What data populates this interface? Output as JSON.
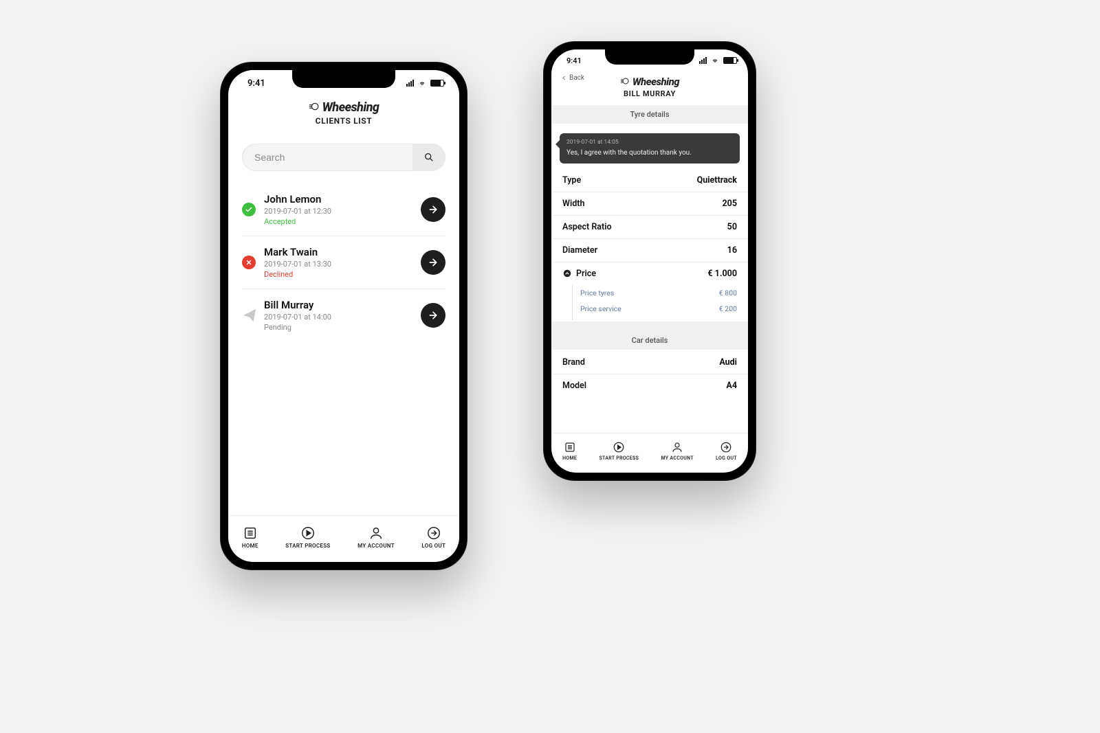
{
  "status_time": "9:41",
  "brand_name": "Wheeshing",
  "phone_a": {
    "subtitle": "CLIENTS LIST",
    "search_placeholder": "Search",
    "clients": [
      {
        "name": "John Lemon",
        "date": "2019-07-01 at 12:30",
        "status_label": "Accepted",
        "status": "accepted"
      },
      {
        "name": "Mark Twain",
        "date": "2019-07-01 at 13:30",
        "status_label": "Declined",
        "status": "declined"
      },
      {
        "name": "Bill Murray",
        "date": "2019-07-01 at 14:00",
        "status_label": "Pending",
        "status": "pending"
      }
    ]
  },
  "phone_b": {
    "back_label": "Back",
    "subtitle": "BILL MURRAY",
    "section_tyre": "Tyre details",
    "message_time": "2019-07-01 at 14:05",
    "message_text": "Yes, I agree with the quotation thank you.",
    "rows": {
      "type": {
        "k": "Type",
        "v": "Quiettrack"
      },
      "width": {
        "k": "Width",
        "v": "205"
      },
      "aspect": {
        "k": "Aspect Ratio",
        "v": "50"
      },
      "diam": {
        "k": "Diameter",
        "v": "16"
      },
      "price": {
        "k": "Price",
        "v": "€ 1.000"
      },
      "pt": {
        "k": "Price tyres",
        "v": "€ 800"
      },
      "ps": {
        "k": "Price service",
        "v": "€ 200"
      }
    },
    "section_car": "Car details",
    "car": {
      "brand": {
        "k": "Brand",
        "v": "Audi"
      },
      "model": {
        "k": "Model",
        "v": "A4"
      }
    }
  },
  "tabs": {
    "home": "HOME",
    "start": "START PROCESS",
    "account": "MY ACCOUNT",
    "logout": "LOG OUT"
  }
}
